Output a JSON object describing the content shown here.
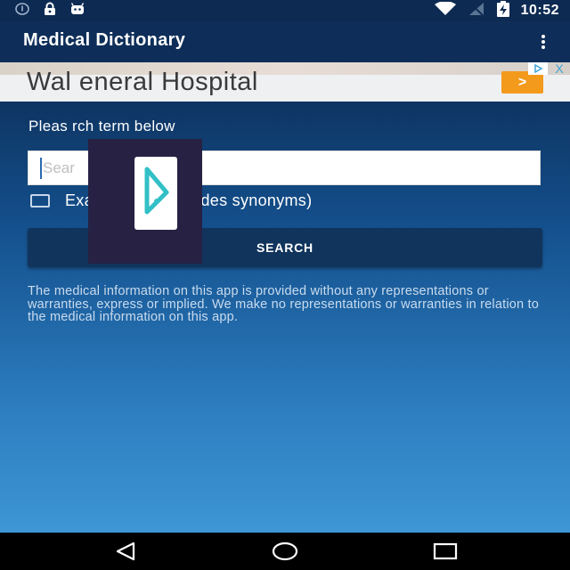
{
  "status_bar": {
    "time": "10:52",
    "icons": [
      "info-icon",
      "lock-icon",
      "android-icon",
      "wifi-icon",
      "signal-icon",
      "battery-charging-icon"
    ]
  },
  "app_bar": {
    "title": "Medical Dictionary",
    "menu_icon": "overflow-menu-icon"
  },
  "ad": {
    "text": "Wal        eneral Hospital",
    "cta": ">",
    "choices_icon": "ad-choices-icon",
    "close_label": "X"
  },
  "search": {
    "prompt": "Pleas          rch term below",
    "placeholder": "Sear",
    "exact_match_label": "Exact match (includes synonyms)",
    "exact_match_checked": false,
    "button_label": "SEARCH"
  },
  "disclaimer": "The medical information on this app is provided without any representations or warranties, express or implied. We make no representations or warranties in relation to the medical information on this app.",
  "overlay": {
    "icon": "play-logo-icon"
  },
  "nav_bar": {
    "icons": [
      "back-icon",
      "home-icon",
      "recents-icon"
    ]
  },
  "colors": {
    "app_bar": "#0e2e59",
    "gradient_top": "#0c2c55",
    "gradient_bottom": "#3e96d4",
    "button": "#11345d",
    "ad_cta": "#f39a1c",
    "overlay": "#272143"
  }
}
